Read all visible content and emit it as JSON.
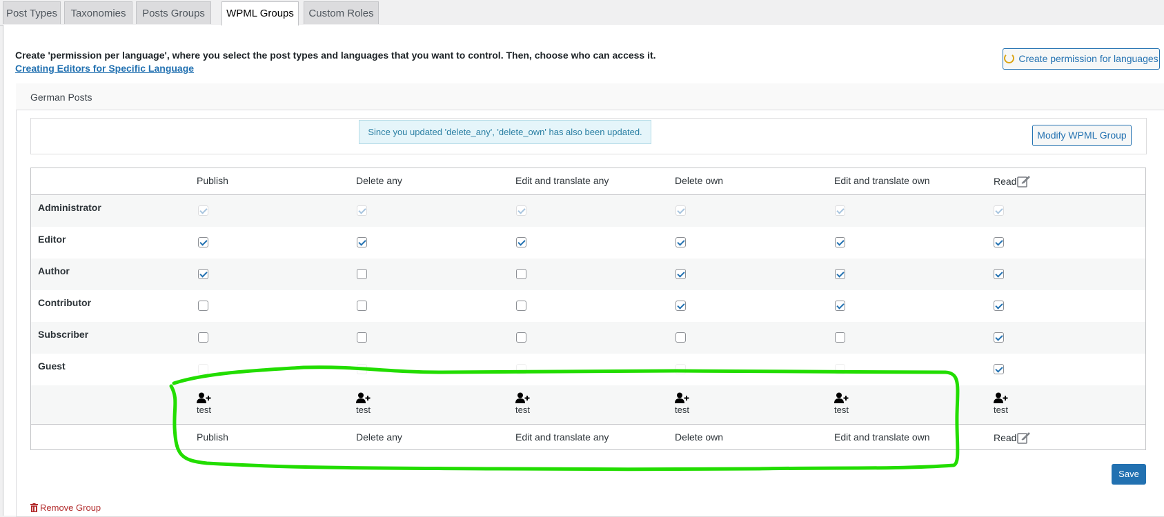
{
  "tabs": [
    {
      "label": "Post Types"
    },
    {
      "label": "Taxonomies"
    },
    {
      "label": "Posts Groups"
    },
    {
      "label": "WPML Groups"
    },
    {
      "label": "Custom Roles"
    }
  ],
  "intro": {
    "text": "Create 'permission per language', where you select the post types and languages that you want to control. Then, choose who can access it.",
    "link": "Creating Editors for Specific Language",
    "create_button": "Create permission for languages"
  },
  "group": {
    "title": "German Posts",
    "notice": "Since you updated 'delete_any', 'delete_own' has also been updated.",
    "modify_button": "Modify WPML Group"
  },
  "columns": [
    "Publish",
    "Delete any",
    "Edit and translate any",
    "Delete own",
    "Edit and translate own",
    "Read"
  ],
  "roles": [
    {
      "name": "Administrator",
      "checks": [
        true,
        true,
        true,
        true,
        true,
        true
      ],
      "disabled": true
    },
    {
      "name": "Editor",
      "checks": [
        true,
        true,
        true,
        true,
        true,
        true
      ]
    },
    {
      "name": "Author",
      "checks": [
        true,
        false,
        false,
        true,
        true,
        true
      ]
    },
    {
      "name": "Contributor",
      "checks": [
        false,
        false,
        false,
        true,
        true,
        true
      ]
    },
    {
      "name": "Subscriber",
      "checks": [
        false,
        false,
        false,
        false,
        false,
        true
      ]
    },
    {
      "name": "Guest",
      "checks": [
        false,
        false,
        false,
        false,
        false,
        true
      ],
      "faint": [
        true,
        true,
        true,
        true,
        true,
        false
      ]
    }
  ],
  "user_label": "test",
  "icons": {
    "add_user": "user-plus-icon",
    "edit": "edit-icon",
    "trash": "trash-icon",
    "spinner": "spinner-icon"
  },
  "save_button": "Save",
  "remove_group": "Remove Group",
  "colors": {
    "accent": "#2271b1",
    "danger": "#b32d2e",
    "annotation": "#22dd00"
  }
}
